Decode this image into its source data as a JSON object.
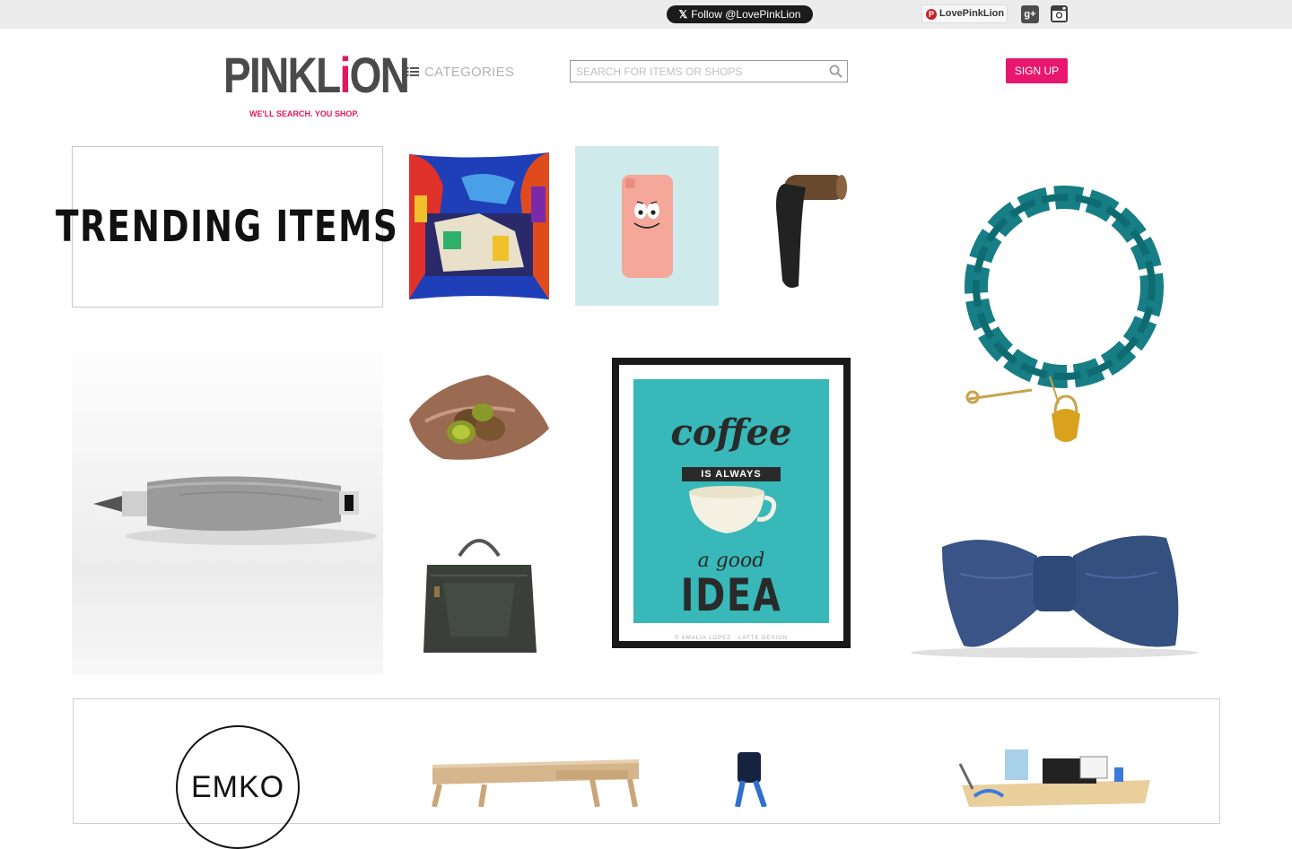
{
  "topbar": {
    "twitter_label": "Follow @LovePinkLion",
    "pinterest_label": "LovePinkLion",
    "gplus_label": "g+"
  },
  "header": {
    "logo_text_1": "PINKL",
    "logo_text_i": "i",
    "logo_text_2": "ON",
    "logo_tm": "™",
    "logo_tagline": "WE'LL SEARCH. YOU SHOP.",
    "categories_label": "CATEGORIES",
    "search_placeholder": "SEARCH FOR ITEMS OR SHOPS",
    "signup_label": "SIGN UP"
  },
  "trending": {
    "heading": "TRENDING ITEMS",
    "items": [
      {
        "icon": "pillow-image"
      },
      {
        "icon": "phone-case-image"
      },
      {
        "icon": "wall-hook-image"
      },
      {
        "icon": "bracelet-image"
      },
      {
        "icon": "pencil-image"
      },
      {
        "icon": "fruit-bowl-image"
      },
      {
        "icon": "poster-image"
      },
      {
        "icon": "handbag-image"
      },
      {
        "icon": "bow-tie-image"
      }
    ],
    "poster": {
      "line1": "coffee",
      "line2": "IS ALWAYS",
      "line3": "a good",
      "line4": "IDEA",
      "credit": "© AMALIA LOPEZ · LATTE DESIGN"
    }
  },
  "shops": {
    "logo_text": "EMKO"
  },
  "colors": {
    "brand_pink": "#e8176e",
    "topbar_bg": "#ececec",
    "logo_gray": "#4a4a4a"
  }
}
